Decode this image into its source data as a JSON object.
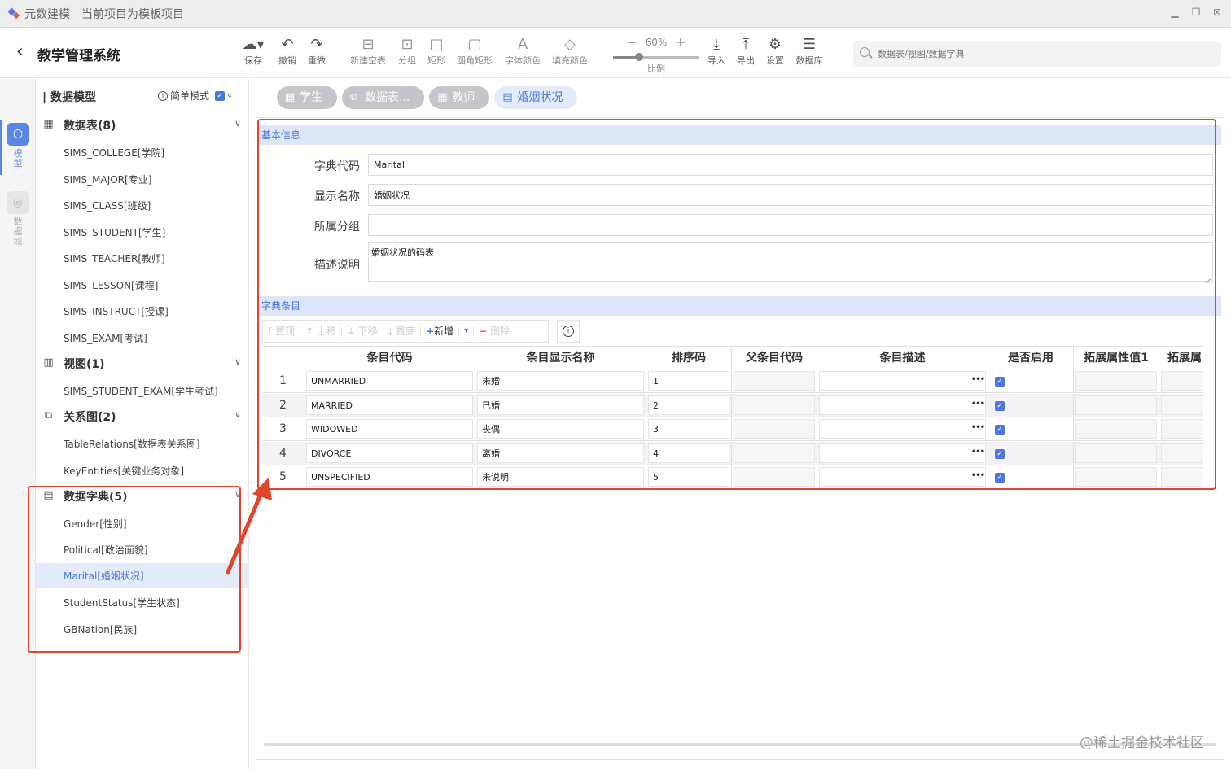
{
  "titlebar": {
    "app_name": "元数建模",
    "project_label": "当前项目为模板项目"
  },
  "header": {
    "back_icon": "chevron-left-icon",
    "system_title": "教学管理系统"
  },
  "toolbar": {
    "save": "保存",
    "undo": "撤销",
    "redo": "重做",
    "new_table": "新建空表",
    "group": "分组",
    "rect": "矩形",
    "rounded_rect": "圆角矩形",
    "font_color": "字体颜色",
    "fill_color": "填充颜色",
    "zoom_value": "60%",
    "zoom_fraction": 0.3,
    "zoom_label": "比例",
    "import": "导入",
    "export": "导出",
    "settings": "设置",
    "database": "数据库"
  },
  "search": {
    "placeholder": "数据表/视图/数据字典"
  },
  "rail": {
    "model": "模型",
    "domain": "数据域"
  },
  "sidebar": {
    "title": "数据模型",
    "simple_mode": "简单模式",
    "groups": {
      "tables": {
        "label": "数据表(8)",
        "items": [
          "SIMS_COLLEGE[学院]",
          "SIMS_MAJOR[专业]",
          "SIMS_CLASS[班级]",
          "SIMS_STUDENT[学生]",
          "SIMS_TEACHER[教师]",
          "SIMS_LESSON[课程]",
          "SIMS_INSTRUCT[授课]",
          "SIMS_EXAM[考试]"
        ]
      },
      "views": {
        "label": "视图(1)",
        "items": [
          "SIMS_STUDENT_EXAM[学生考试]"
        ]
      },
      "diagrams": {
        "label": "关系图(2)",
        "items": [
          "TableRelations[数据表关系图]",
          "KeyEntities[关键业务对象]"
        ]
      },
      "dicts": {
        "label": "数据字典(5)",
        "items": [
          "Gender[性别]",
          "Political[政治面貌]",
          "Marital[婚姻状况]",
          "StudentStatus[学生状态]",
          "GBNation[民族]"
        ]
      }
    }
  },
  "tabs": [
    "学生",
    "数据表...",
    "教师",
    "婚姻状况"
  ],
  "basic": {
    "header": "基本信息",
    "code_label": "字典代码",
    "code_value": "Marital",
    "name_label": "显示名称",
    "name_value": "婚姻状况",
    "group_label": "所属分组",
    "group_value": "",
    "desc_label": "描述说明",
    "desc_value": "婚姻状况的码表"
  },
  "items_section": {
    "header": "字典条目",
    "tools": {
      "top": "置顶",
      "up": "上移",
      "down": "下移",
      "bottom": "置底",
      "add": "新增",
      "delete": "删除"
    }
  },
  "grid": {
    "columns": [
      "条目代码",
      "条目显示名称",
      "排序码",
      "父条目代码",
      "条目描述",
      "是否启用",
      "拓展属性值1",
      "拓展属"
    ],
    "rows": [
      {
        "num": "1",
        "code": "UNMARRIED",
        "name": "未婚",
        "sort": "1",
        "parent": "",
        "desc": "",
        "enabled": true
      },
      {
        "num": "2",
        "code": "MARRIED",
        "name": "已婚",
        "sort": "2",
        "parent": "",
        "desc": "",
        "enabled": true
      },
      {
        "num": "3",
        "code": "WIDOWED",
        "name": "丧偶",
        "sort": "3",
        "parent": "",
        "desc": "",
        "enabled": true
      },
      {
        "num": "4",
        "code": "DIVORCE",
        "name": "离婚",
        "sort": "4",
        "parent": "",
        "desc": "",
        "enabled": true
      },
      {
        "num": "5",
        "code": "UNSPECIFIED",
        "name": "未说明",
        "sort": "5",
        "parent": "",
        "desc": "",
        "enabled": true
      }
    ]
  },
  "colors": {
    "accent": "#4a78e0",
    "annotation": "#e2452f",
    "section_bg": "#dfe6f8"
  },
  "watermark": "@稀土掘金技术社区"
}
